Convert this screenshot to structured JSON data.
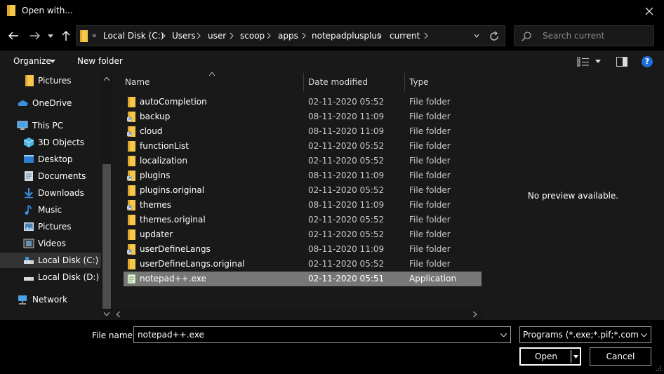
{
  "window": {
    "title": "Open with..."
  },
  "address": {
    "overflow": "«",
    "crumbs": [
      "Local Disk (C:)",
      "Users",
      "user",
      "scoop",
      "apps",
      "notepadplusplus",
      "current"
    ]
  },
  "search": {
    "placeholder": "Search current"
  },
  "toolbar": {
    "organize": "Organize",
    "new_folder": "New folder"
  },
  "nav": {
    "items": [
      {
        "label": "Pictures",
        "icon": "folder-icon"
      },
      {
        "label": "OneDrive",
        "icon": "cloud-icon"
      },
      {
        "label": "This PC",
        "icon": "computer-icon"
      },
      {
        "label": "3D Objects",
        "icon": "cube-icon"
      },
      {
        "label": "Desktop",
        "icon": "desktop-icon"
      },
      {
        "label": "Documents",
        "icon": "documents-icon"
      },
      {
        "label": "Downloads",
        "icon": "download-icon"
      },
      {
        "label": "Music",
        "icon": "music-icon"
      },
      {
        "label": "Pictures",
        "icon": "pictures-icon"
      },
      {
        "label": "Videos",
        "icon": "videos-icon"
      },
      {
        "label": "Local Disk (C:)",
        "icon": "drive-icon",
        "selected": true
      },
      {
        "label": "Local Disk (D:)",
        "icon": "drive-icon"
      },
      {
        "label": "Network",
        "icon": "network-icon"
      }
    ]
  },
  "columns": {
    "name": "Name",
    "date": "Date modified",
    "type": "Type"
  },
  "files": [
    {
      "name": "autoCompletion",
      "date": "02-11-2020 05:52",
      "type": "File folder",
      "icon": "folder-icon"
    },
    {
      "name": "backup",
      "date": "08-11-2020 11:09",
      "type": "File folder",
      "icon": "folder-shortcut-icon"
    },
    {
      "name": "cloud",
      "date": "08-11-2020 11:09",
      "type": "File folder",
      "icon": "folder-shortcut-icon"
    },
    {
      "name": "functionList",
      "date": "02-11-2020 05:52",
      "type": "File folder",
      "icon": "folder-icon"
    },
    {
      "name": "localization",
      "date": "02-11-2020 05:52",
      "type": "File folder",
      "icon": "folder-icon"
    },
    {
      "name": "plugins",
      "date": "08-11-2020 11:09",
      "type": "File folder",
      "icon": "folder-shortcut-icon"
    },
    {
      "name": "plugins.original",
      "date": "02-11-2020 05:52",
      "type": "File folder",
      "icon": "folder-icon"
    },
    {
      "name": "themes",
      "date": "08-11-2020 11:09",
      "type": "File folder",
      "icon": "folder-shortcut-icon"
    },
    {
      "name": "themes.original",
      "date": "02-11-2020 05:52",
      "type": "File folder",
      "icon": "folder-icon"
    },
    {
      "name": "updater",
      "date": "02-11-2020 05:52",
      "type": "File folder",
      "icon": "folder-icon"
    },
    {
      "name": "userDefineLangs",
      "date": "08-11-2020 11:09",
      "type": "File folder",
      "icon": "folder-shortcut-icon"
    },
    {
      "name": "userDefineLangs.original",
      "date": "02-11-2020 05:52",
      "type": "File folder",
      "icon": "folder-icon"
    },
    {
      "name": "notepad++.exe",
      "date": "02-11-2020 05:51",
      "type": "Application",
      "icon": "notepad-app-icon",
      "selected": true
    }
  ],
  "preview": {
    "text": "No preview available."
  },
  "footer": {
    "file_name_label": "File name:",
    "file_name_value": "notepad++.exe",
    "file_type_value": "Programs (*.exe;*.pif;*.com;*.bat;*.cmd)",
    "open_label": "Open",
    "cancel_label": "Cancel"
  },
  "colors": {
    "background": "#000000",
    "pane": "#191919",
    "selected_row": "#777777",
    "folder": "#f5c84c",
    "help_blue": "#1e6fd9"
  }
}
